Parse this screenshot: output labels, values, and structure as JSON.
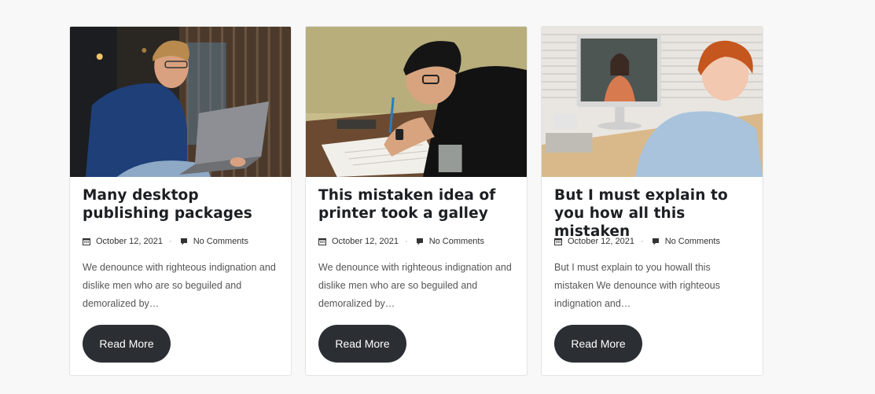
{
  "posts": [
    {
      "title": "Many desktop publishing packages",
      "date": "October 12, 2021",
      "comments": "No Comments",
      "excerpt": "We denounce with righteous indignation and dislike men who are so beguiled and demoralized by…",
      "button": "Read More"
    },
    {
      "title": "This mistaken idea of printer took a galley",
      "date": "October 12, 2021",
      "comments": "No Comments",
      "excerpt": "We denounce with righteous indignation and dislike men who are so beguiled and demoralized by…",
      "button": "Read More"
    },
    {
      "title": "But I must explain to you how all this mistaken",
      "date": "October 12, 2021",
      "comments": "No Comments",
      "excerpt": "But I must explain to you howall this mistaken We denounce with righteous indignation and…",
      "button": "Read More"
    }
  ],
  "icons": {
    "date": "calendar-icon",
    "comments": "comment-icon",
    "separator": "·"
  },
  "colors": {
    "button_bg": "#2b2f33",
    "title": "#1c1f22",
    "text": "#555555"
  }
}
